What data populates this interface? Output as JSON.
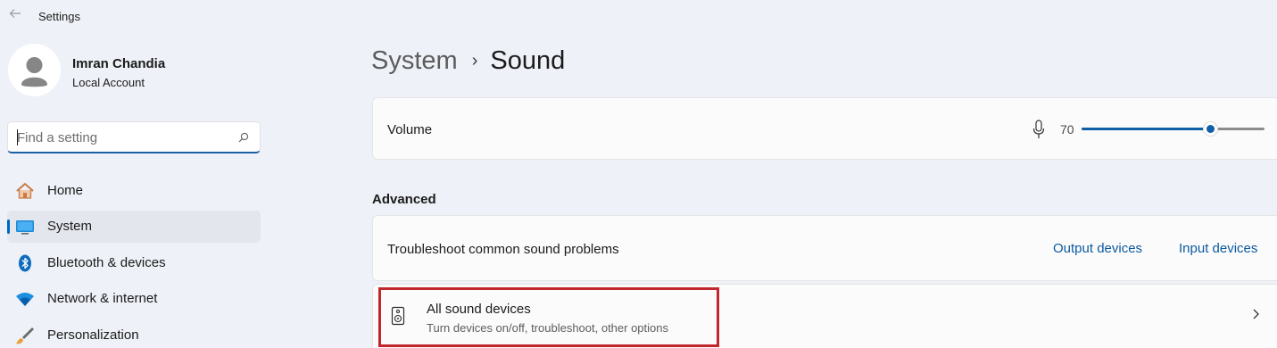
{
  "window": {
    "title": "Settings"
  },
  "account": {
    "name": "Imran Chandia",
    "type": "Local Account"
  },
  "search": {
    "placeholder": "Find a setting",
    "value": ""
  },
  "nav": {
    "items": [
      {
        "label": "Home",
        "icon": "home-icon",
        "selected": false
      },
      {
        "label": "System",
        "icon": "system-icon",
        "selected": true
      },
      {
        "label": "Bluetooth & devices",
        "icon": "bluetooth-icon",
        "selected": false
      },
      {
        "label": "Network & internet",
        "icon": "wifi-icon",
        "selected": false
      },
      {
        "label": "Personalization",
        "icon": "brush-icon",
        "selected": false
      }
    ]
  },
  "breadcrumb": {
    "parent": "System",
    "separator": "›",
    "current": "Sound"
  },
  "volume": {
    "label": "Volume",
    "icon": "microphone-icon",
    "value": 70
  },
  "advanced": {
    "title": "Advanced",
    "troubleshoot": {
      "label": "Troubleshoot common sound problems",
      "output_link": "Output devices",
      "input_link": "Input devices"
    },
    "all_devices": {
      "title": "All sound devices",
      "subtitle": "Turn devices on/off, troubleshoot, other options",
      "icon": "speaker-icon",
      "highlighted": true
    }
  },
  "colors": {
    "accent": "#0067c0",
    "slider": "#0f5ea8",
    "link": "#0b5a9e",
    "highlight": "#c1272d",
    "background": "#eef1f7",
    "card": "#fbfbfc"
  }
}
